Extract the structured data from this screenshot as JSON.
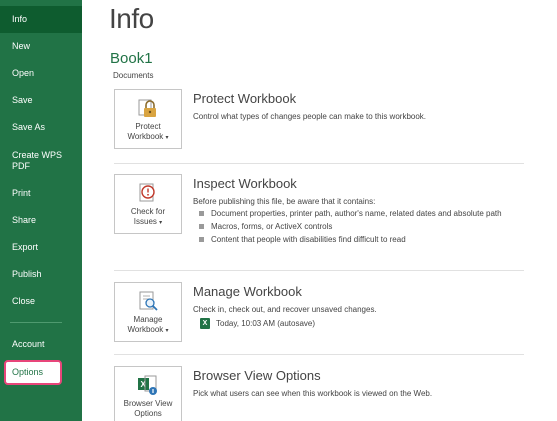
{
  "sidebar": {
    "items": [
      {
        "label": "Info"
      },
      {
        "label": "New"
      },
      {
        "label": "Open"
      },
      {
        "label": "Save"
      },
      {
        "label": "Save As"
      },
      {
        "label": "Create WPS PDF"
      },
      {
        "label": "Print"
      },
      {
        "label": "Share"
      },
      {
        "label": "Export"
      },
      {
        "label": "Publish"
      },
      {
        "label": "Close"
      },
      {
        "label": "Account"
      },
      {
        "label": "Options"
      }
    ],
    "create_wps_line1": "Create WPS",
    "create_wps_line2": "PDF"
  },
  "main": {
    "title": "Info",
    "workbook_name": "Book1",
    "workbook_location": "Documents",
    "sections": {
      "protect": {
        "button_line1": "Protect",
        "button_line2": "Workbook",
        "title": "Protect Workbook",
        "description": "Control what types of changes people can make to this workbook."
      },
      "inspect": {
        "button_line1": "Check for",
        "button_line2": "Issues",
        "title": "Inspect Workbook",
        "description": "Before publishing this file, be aware that it contains:",
        "bullets": [
          "Document properties, printer path, author's name, related dates and absolute path",
          "Macros, forms, or ActiveX controls",
          "Content that people with disabilities find difficult to read"
        ]
      },
      "manage": {
        "button_line1": "Manage",
        "button_line2": "Workbook",
        "title": "Manage Workbook",
        "description": "Check in, check out, and recover unsaved changes.",
        "version": "Today, 10:03 AM (autosave)"
      },
      "browser": {
        "button_line1": "Browser View",
        "button_line2": "Options",
        "title": "Browser View Options",
        "description": "Pick what users can see when this workbook is viewed on the Web."
      }
    }
  },
  "colors": {
    "sidebar": "#217346",
    "sidebar_active": "#0e5c2f",
    "highlight": "#e8457a",
    "accent": "#217346"
  }
}
